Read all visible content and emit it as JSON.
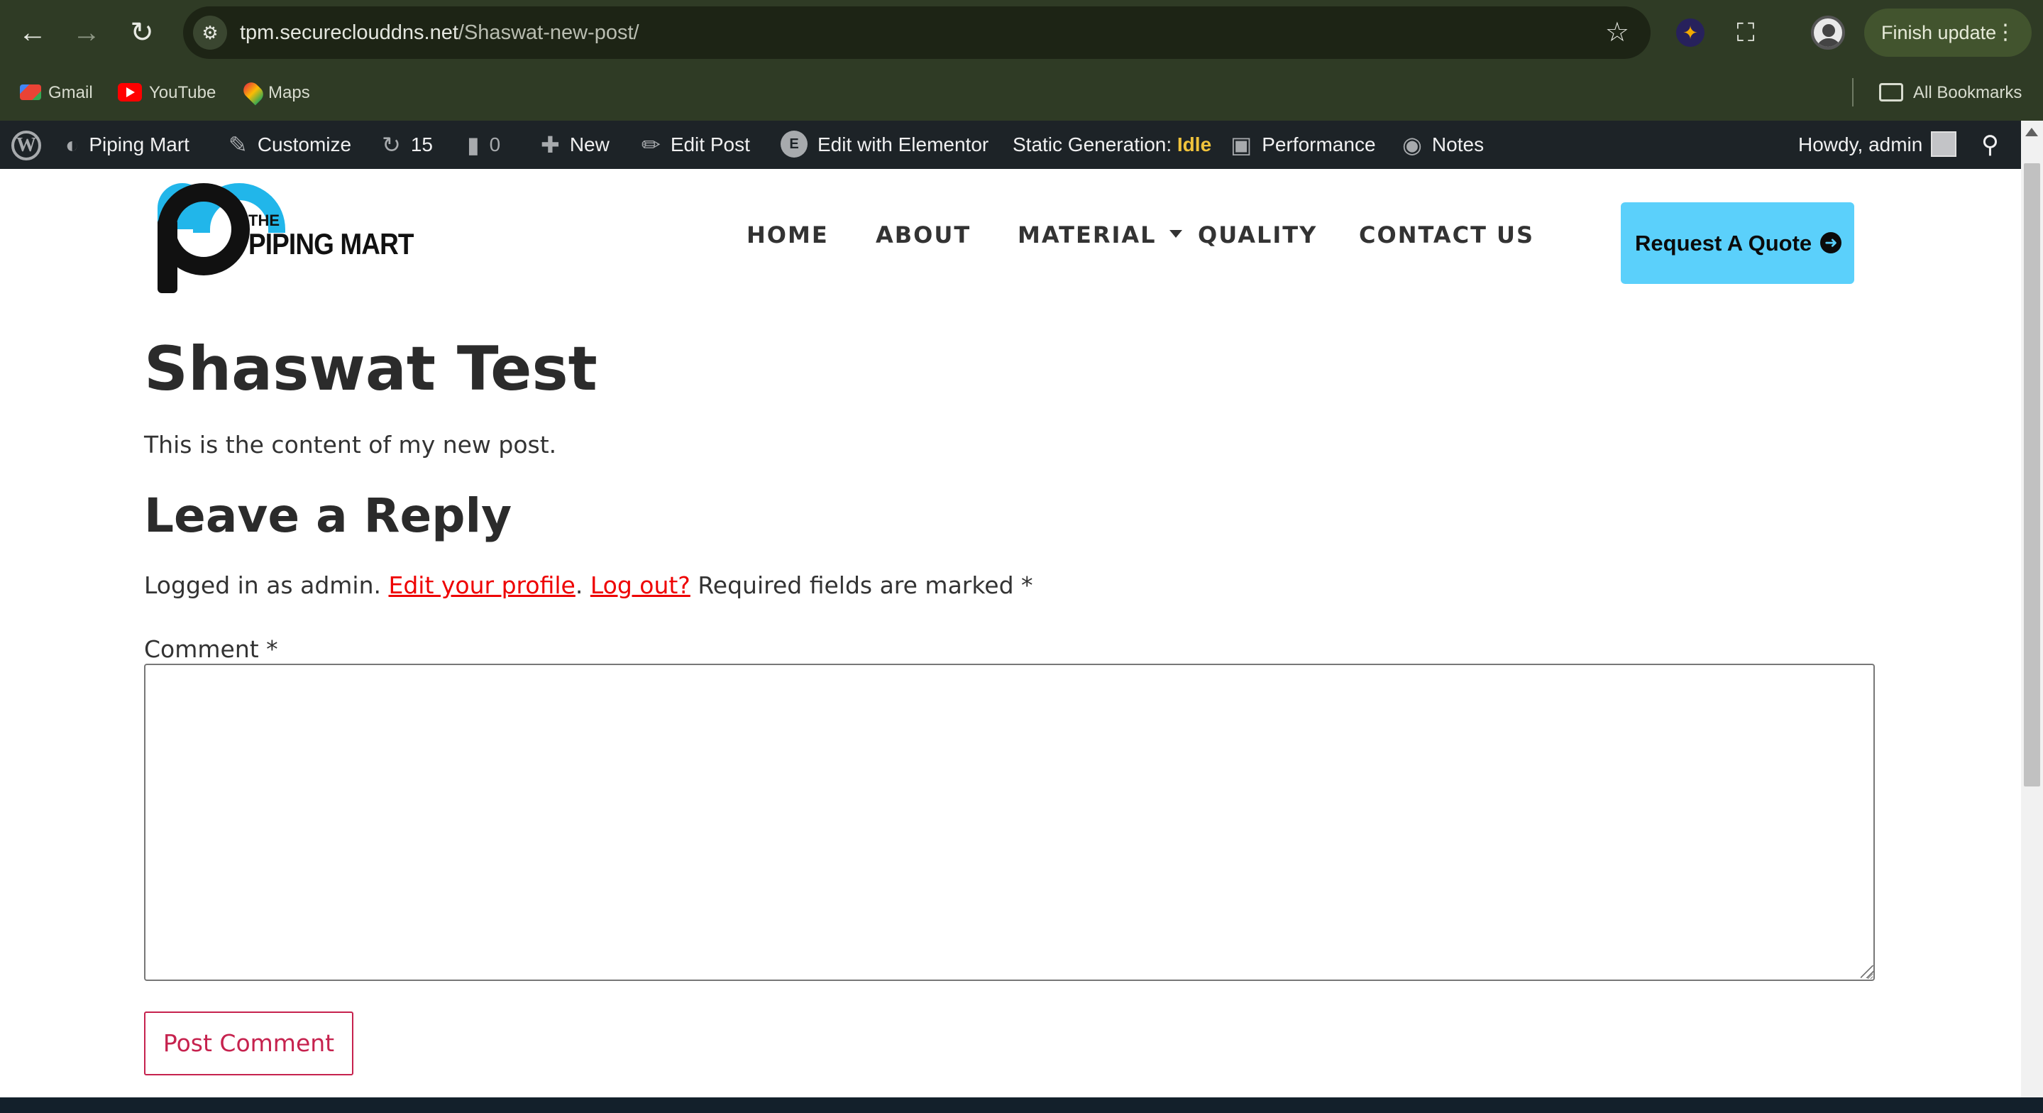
{
  "browser": {
    "url_host": "tpm.secureclouddns.net",
    "url_path": "/Shaswat-new-post/",
    "finish_update_label": "Finish update",
    "bookmarks": [
      {
        "label": "Gmail",
        "icon": "gmail-icon"
      },
      {
        "label": "YouTube",
        "icon": "youtube-icon"
      },
      {
        "label": "Maps",
        "icon": "maps-icon"
      }
    ],
    "all_bookmarks_label": "All Bookmarks"
  },
  "admin_bar": {
    "site_name": "Piping Mart",
    "customize": "Customize",
    "updates_count": "15",
    "comments_count": "0",
    "new": "New",
    "edit_post": "Edit Post",
    "edit_elementor": "Edit with Elementor",
    "static_generation_label": "Static Generation:",
    "static_generation_status": "Idle",
    "performance": "Performance",
    "notes": "Notes",
    "howdy": "Howdy, admin"
  },
  "site_header": {
    "logo_the": "THE",
    "logo_name": "PIPING MART",
    "menu": [
      {
        "label": "HOME"
      },
      {
        "label": "ABOUT"
      },
      {
        "label": "MATERIAL"
      },
      {
        "label": "QUALITY"
      },
      {
        "label": "CONTACT US"
      }
    ],
    "quote_button": "Request A Quote"
  },
  "post": {
    "title": "Shaswat Test",
    "body": "This is the content of my new post."
  },
  "reply": {
    "title": "Leave a Reply",
    "logged_in_prefix": "Logged in as admin.",
    "edit_profile": "Edit your profile",
    "period": ".",
    "log_out": "Log out?",
    "required_note": "Required fields are marked *",
    "comment_label": "Comment *",
    "submit_label": "Post Comment"
  },
  "colors": {
    "browser_bar": "#2f3b25",
    "wp_admin_bar": "#1d2327",
    "quote_button": "#5bd0fb",
    "link_red": "#e00000",
    "submit_accent": "#c6224e"
  }
}
